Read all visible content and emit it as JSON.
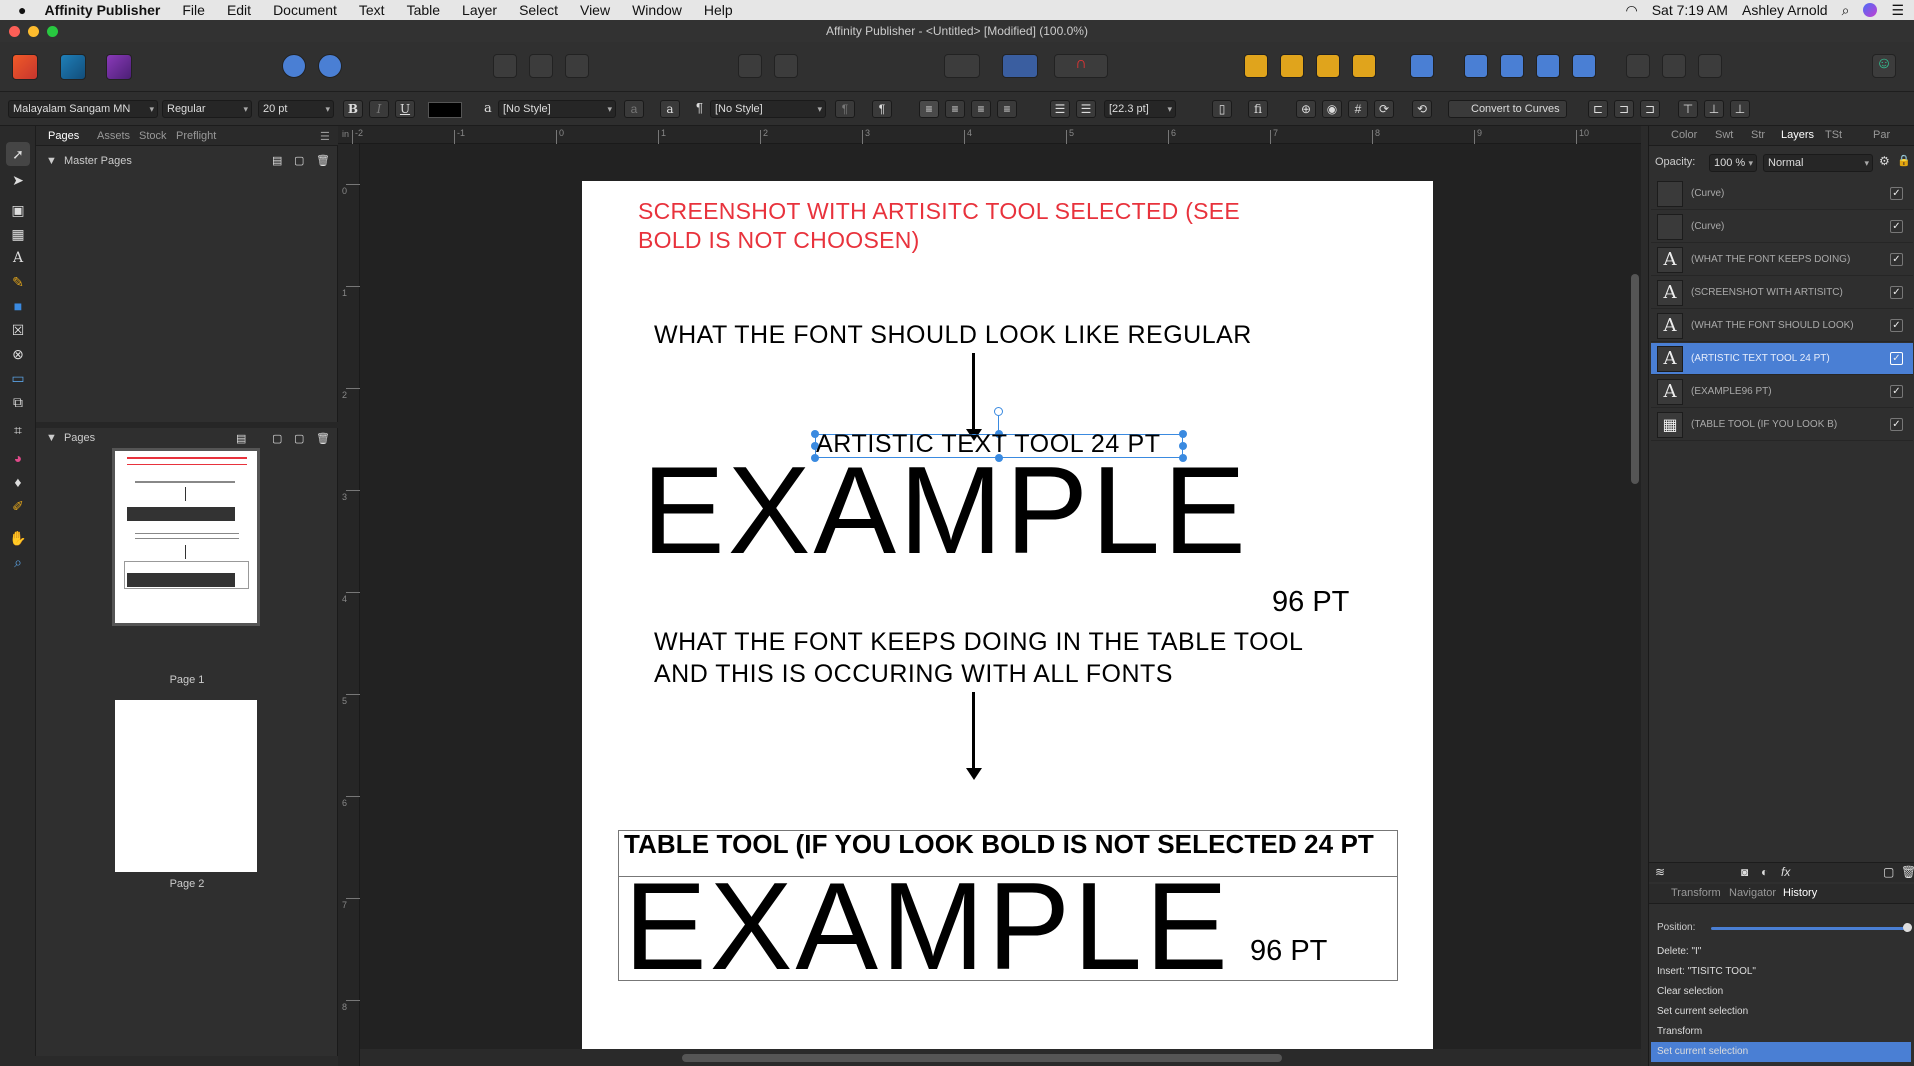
{
  "menubar": {
    "app_name": "Affinity Publisher",
    "items": [
      "File",
      "Edit",
      "Document",
      "Text",
      "Table",
      "Layer",
      "Select",
      "View",
      "Window",
      "Help"
    ],
    "clock": "Sat 7:19 AM",
    "user": "Ashley Arnold"
  },
  "window": {
    "title": "Affinity Publisher - <Untitled> [Modified] (100.0%)"
  },
  "context_toolbar": {
    "font_family": "Malayalam Sangam MN",
    "font_style": "Regular",
    "font_size": "20 pt",
    "bold": "B",
    "italic": "I",
    "underline": "U",
    "char_style": "[No Style]",
    "para_style": "[No Style]",
    "leading": "[22.3 pt]",
    "convert_label": "Convert to Curves"
  },
  "pages_panel": {
    "tabs": [
      "Pages",
      "Assets",
      "Stock",
      "Preflight"
    ],
    "active_tab": "Pages",
    "master_pages_label": "Master Pages",
    "pages_label": "Pages",
    "page1_label": "Page 1",
    "page2_label": "Page 2"
  },
  "ruler": {
    "h_unit": "in",
    "h_ticks": [
      "-2",
      "-1",
      "0",
      "1",
      "2",
      "3",
      "4",
      "5",
      "6",
      "7",
      "8",
      "9",
      "10"
    ],
    "v_ticks": [
      "0",
      "1",
      "2",
      "3",
      "4",
      "5",
      "6",
      "7",
      "8"
    ]
  },
  "document": {
    "red_note": "SCREENSHOT WITH ARTISITC TOOL SELECTED (SEE BOLD IS NOT CHOOSEN)",
    "heading1": "WHAT THE FONT SHOULD LOOK LIKE REGULAR",
    "artistic_text": "ARTISTIC TEXT TOOL 24 PT",
    "example_big": "EXAMPLE",
    "example_small": "96 PT",
    "heading2_line1": "WHAT THE FONT KEEPS DOING IN THE TABLE TOOL",
    "heading2_line2": "AND THIS IS OCCURING WITH ALL FONTS",
    "table_row1": "TABLE TOOL (IF YOU LOOK BOLD IS NOT SELECTED 24 PT",
    "table_example_big": "EXAMPLE",
    "table_example_small": "96 PT",
    "red_color": "#e8323c"
  },
  "right_panel": {
    "tabs": [
      "Color",
      "Swt",
      "Str",
      "Layers",
      "TSt",
      "Par"
    ],
    "active_tab": "Layers",
    "opacity_label": "Opacity:",
    "opacity_value": "100 %",
    "blend_mode": "Normal",
    "layers": [
      {
        "icon": "curve",
        "name": "(Curve)",
        "checked": true,
        "selected": false
      },
      {
        "icon": "curve",
        "name": "(Curve)",
        "checked": true,
        "selected": false
      },
      {
        "icon": "text",
        "name": "(WHAT THE FONT KEEPS DOING)",
        "checked": true,
        "selected": false
      },
      {
        "icon": "text",
        "name": "(SCREENSHOT WITH ARTISITC)",
        "checked": true,
        "selected": false
      },
      {
        "icon": "text",
        "name": "(WHAT THE FONT SHOULD LOOK)",
        "checked": true,
        "selected": false
      },
      {
        "icon": "text",
        "name": "(ARTISTIC TEXT TOOL 24 PT)",
        "checked": true,
        "selected": true
      },
      {
        "icon": "text",
        "name": "(EXAMPLE96 PT)",
        "checked": true,
        "selected": false
      },
      {
        "icon": "table",
        "name": "(TABLE TOOL (IF YOU LOOK B)",
        "checked": true,
        "selected": false
      }
    ],
    "bottom_tabs": [
      "Transform",
      "Navigator",
      "History"
    ],
    "bottom_active": "History",
    "position_label": "Position:",
    "history": [
      {
        "text": "Delete: \"I\"",
        "selected": false
      },
      {
        "text": "Insert: \"TISITC TOOL\"",
        "selected": false
      },
      {
        "text": "Clear selection",
        "selected": false
      },
      {
        "text": "Set current selection",
        "selected": false
      },
      {
        "text": "Transform",
        "selected": false
      },
      {
        "text": "Set current selection",
        "selected": true
      }
    ],
    "selection_color": "#4a7fd4"
  }
}
